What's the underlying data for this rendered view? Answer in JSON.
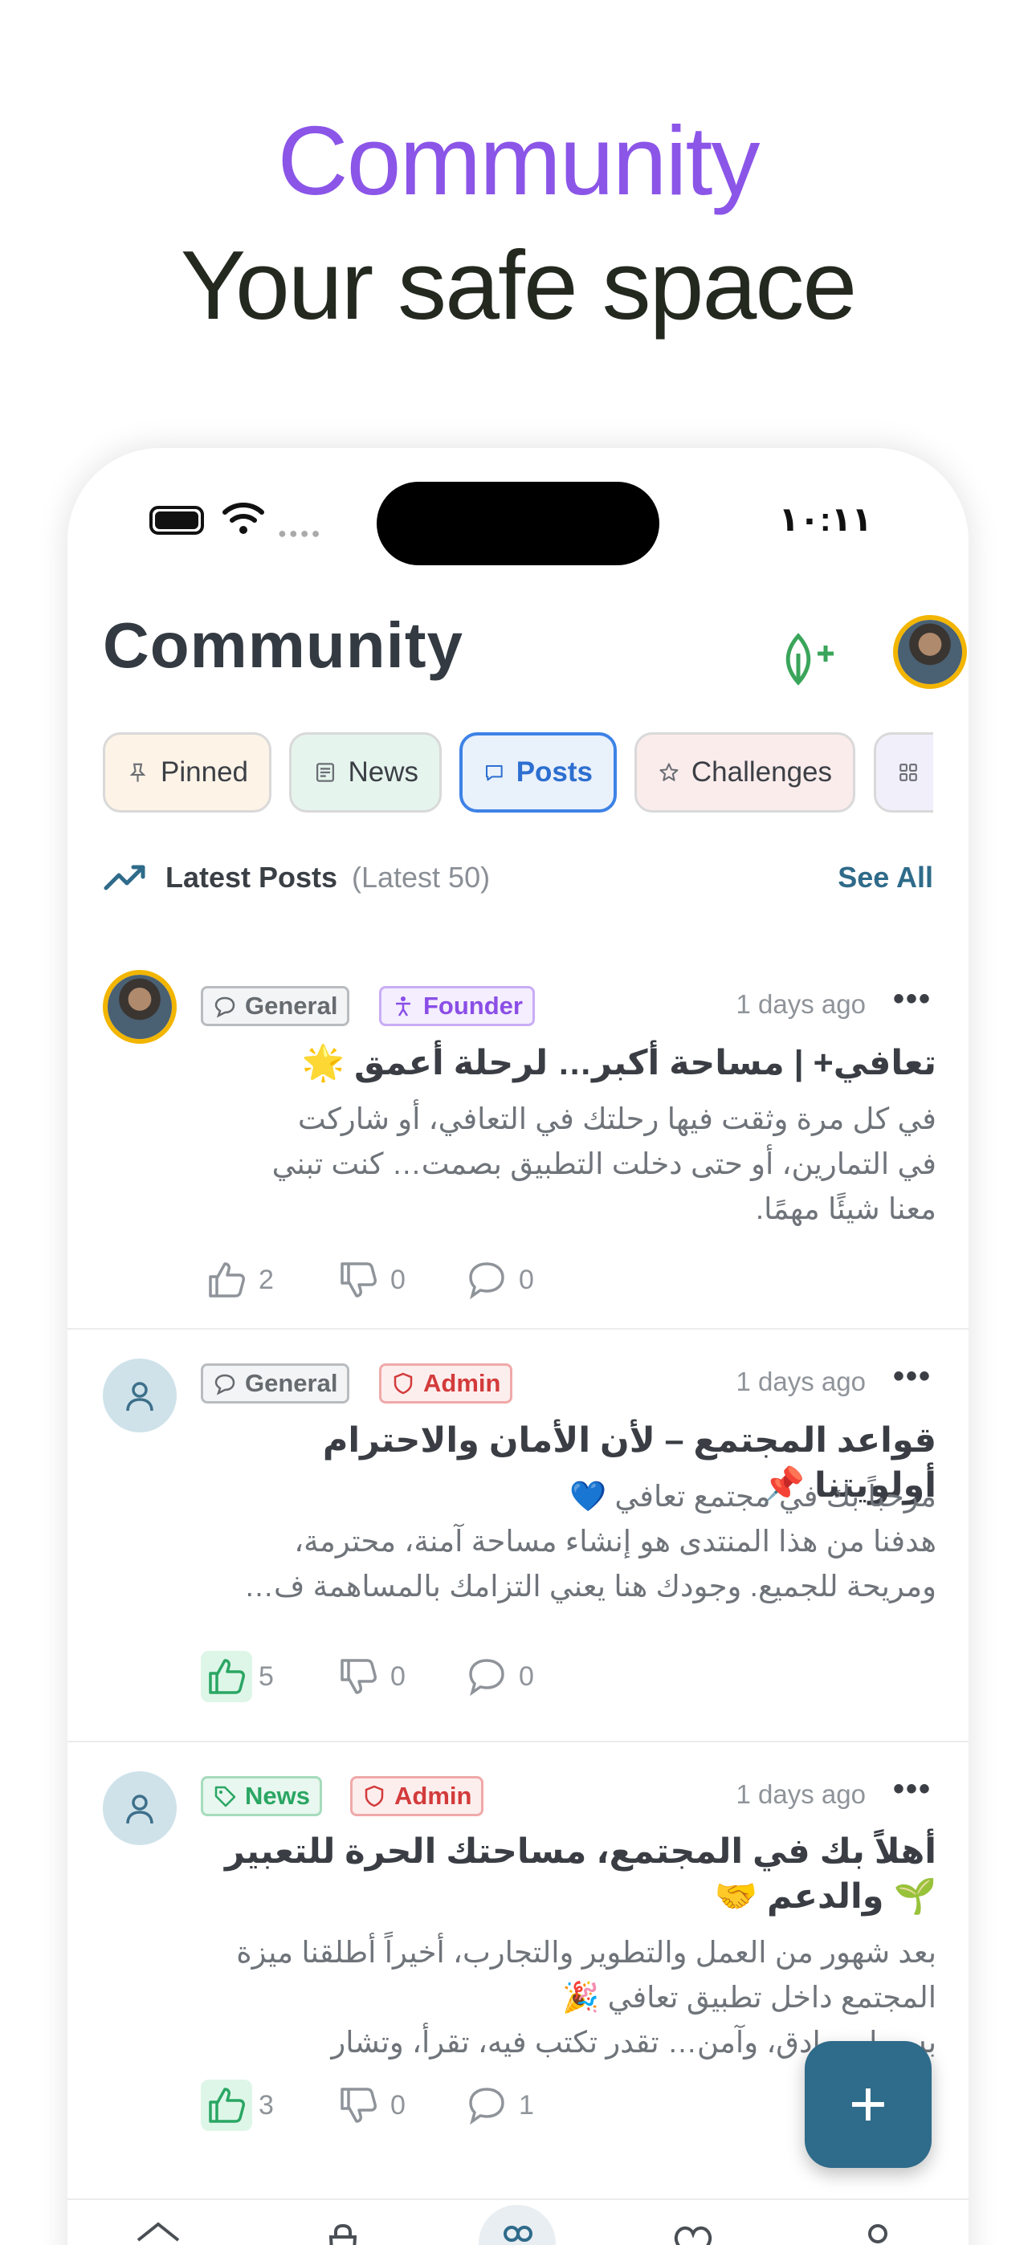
{
  "promo": {
    "title": "Community",
    "subtitle": "Your safe space"
  },
  "status_bar": {
    "time": "١٠:١١"
  },
  "header": {
    "title": "Community"
  },
  "tabs": [
    {
      "label": "Pinned",
      "icon": "pin-icon"
    },
    {
      "label": "News",
      "icon": "newspaper-icon"
    },
    {
      "label": "Posts",
      "icon": "chat-icon",
      "active": true
    },
    {
      "label": "Challenges",
      "icon": "star-icon"
    },
    {
      "label": "",
      "icon": "grid-icon"
    }
  ],
  "latest": {
    "label": "Latest Posts",
    "sub": "(Latest 50)",
    "see_all": "See All"
  },
  "posts": [
    {
      "badges": [
        "General",
        "Founder"
      ],
      "time": "1 days ago",
      "title": "تعافي+ | مساحة أكبر… لرحلة أعمق 🌟",
      "body": "في كل مرة وثقت فيها رحلتك في التعافي، أو شاركت\nفي التمارين، أو حتى دخلت التطبيق بصمت… كنت تبني\nمعنا شيئًا مهمًا.",
      "likes": "2",
      "dislikes": "0",
      "comments": "0"
    },
    {
      "badges": [
        "General",
        "Admin"
      ],
      "time": "1 days ago",
      "title": "قواعد المجتمع – لأن الأمان والاحترام أولويتنا 📌",
      "body": "مرحباً بك في مجتمع تعافي 💙\nهدفنا من هذا المنتدى هو إنشاء مساحة آمنة، محترمة،\nومريحة للجميع. وجودك هنا يعني التزامك بالمساهمة ف…",
      "likes": "5",
      "dislikes": "0",
      "comments": "0"
    },
    {
      "badges": [
        "News",
        "Admin"
      ],
      "time": "1 days ago",
      "title": "أهلاً بك في المجتمع، مساحتك الحرة للتعبير 🌱 والدعم 🤝",
      "body": "بعد شهور من العمل والتطوير والتجارب، أخيراً أطلقنا ميزة\nالمجتمع داخل تطبيق تعافي 🎉\nبسيط، صادق، وآمن… تقدر تكتب فيه، تقرأ، وتشار",
      "likes": "3",
      "dislikes": "0",
      "comments": "1"
    }
  ],
  "fab": {
    "label": "+"
  },
  "colors": {
    "brand": "#2f6b8a",
    "accent": "#8b55e8",
    "active_tab": "#3d82e6",
    "founder": "#8a4ee6",
    "admin": "#d33b3b",
    "news": "#2aa663"
  }
}
